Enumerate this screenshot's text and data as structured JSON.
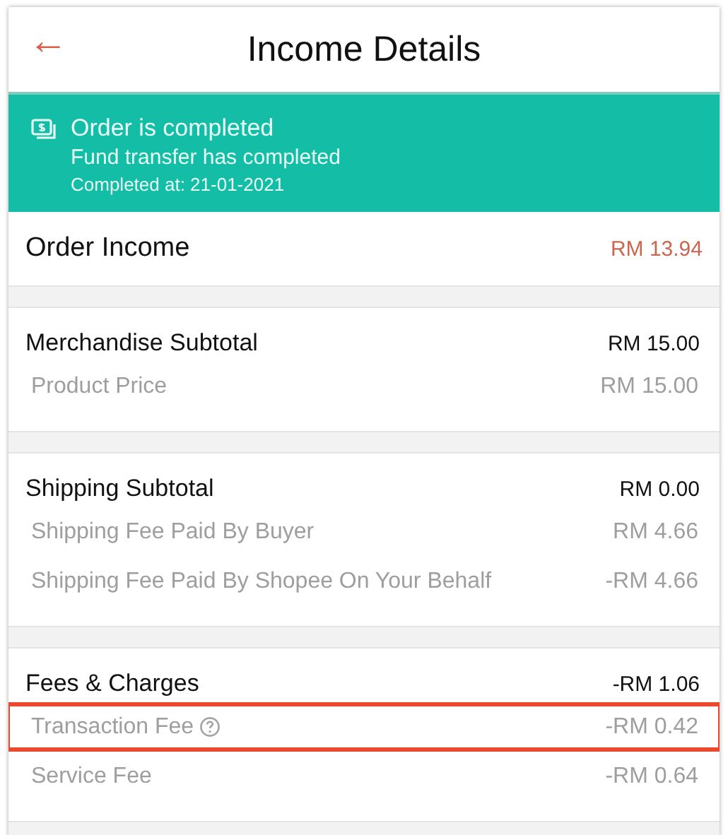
{
  "header": {
    "title": "Income Details",
    "back": "←"
  },
  "status_banner": {
    "title": "Order is completed",
    "subtitle": "Fund transfer has completed",
    "completed_at": "Completed at: 21-01-2021"
  },
  "order_income": {
    "label": "Order Income",
    "amount": "RM 13.94"
  },
  "sections": [
    {
      "title": "Merchandise Subtotal",
      "amount": "RM 15.00",
      "items": [
        {
          "label": "Product Price",
          "amount": "RM 15.00",
          "help": false,
          "highlighted": false
        }
      ]
    },
    {
      "title": "Shipping Subtotal",
      "amount": "RM 0.00",
      "items": [
        {
          "label": "Shipping Fee Paid By Buyer",
          "amount": "RM 4.66",
          "help": false,
          "highlighted": false
        },
        {
          "label": "Shipping Fee Paid By Shopee On Your Behalf",
          "amount": "-RM 4.66",
          "help": false,
          "highlighted": false
        }
      ]
    },
    {
      "title": "Fees & Charges",
      "amount": "-RM 1.06",
      "items": [
        {
          "label": "Transaction Fee",
          "amount": "-RM 0.42",
          "help": true,
          "highlighted": true
        },
        {
          "label": "Service Fee",
          "amount": "-RM 0.64",
          "help": false,
          "highlighted": false
        }
      ]
    }
  ]
}
